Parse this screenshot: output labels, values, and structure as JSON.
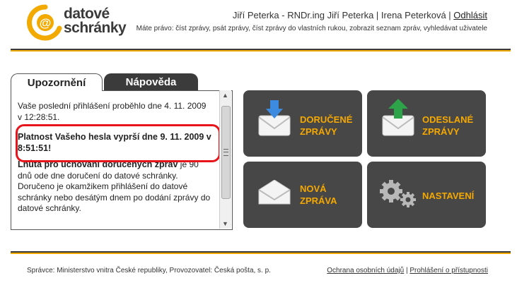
{
  "brand": {
    "line1": "datové",
    "line2": "schránky"
  },
  "header": {
    "users": "Jiří Peterka - RNDr.ing Jiří Peterka | Irena Peterková |",
    "logout_label": "Odhlásit",
    "rights": "Máte právo: číst zprávy, psát zprávy, číst zprávy do vlastních rukou, zobrazit seznam zpráv, vyhledávat uživatele"
  },
  "tabs": {
    "notices": "Upozornění",
    "help": "Nápověda"
  },
  "notices": {
    "last_login": "Vaše poslední přihlášení proběhlo dne 4. 11. 2009 v 12:28:51.",
    "password_expiry": "Platnost Vašeho hesla vyprší dne 9. 11. 2009 v 8:51:51!",
    "retention_title": "Lhůta pro uchování doručených zpráv",
    "retention_text": "je 90 dnů ode dne doručení do datové schránky. Doručeno je okamžikem přihlášení do datové schránky nebo desátým dnem po dodání zprávy do datové schránky."
  },
  "tiles": {
    "received": "Doručené zprávy",
    "sent": "Odeslané zprávy",
    "new": "Nová zpráva",
    "settings": "Nastavení"
  },
  "icons": {
    "received": "envelope-arrow-down-icon",
    "sent": "envelope-arrow-up-icon",
    "new": "open-envelope-icon",
    "settings": "gears-icon"
  },
  "colors": {
    "accent": "#f5a800",
    "tile_bg": "#474747",
    "alert_border": "#e8141b"
  },
  "footer": {
    "operators": "Správce: Ministerstvo vnitra České republiky, Provozovatel: Česká pošta, s. p.",
    "privacy_link": "Ochrana osobních údajů",
    "separator": "|",
    "accessibility_link": "Prohlášení o přístupnosti"
  }
}
